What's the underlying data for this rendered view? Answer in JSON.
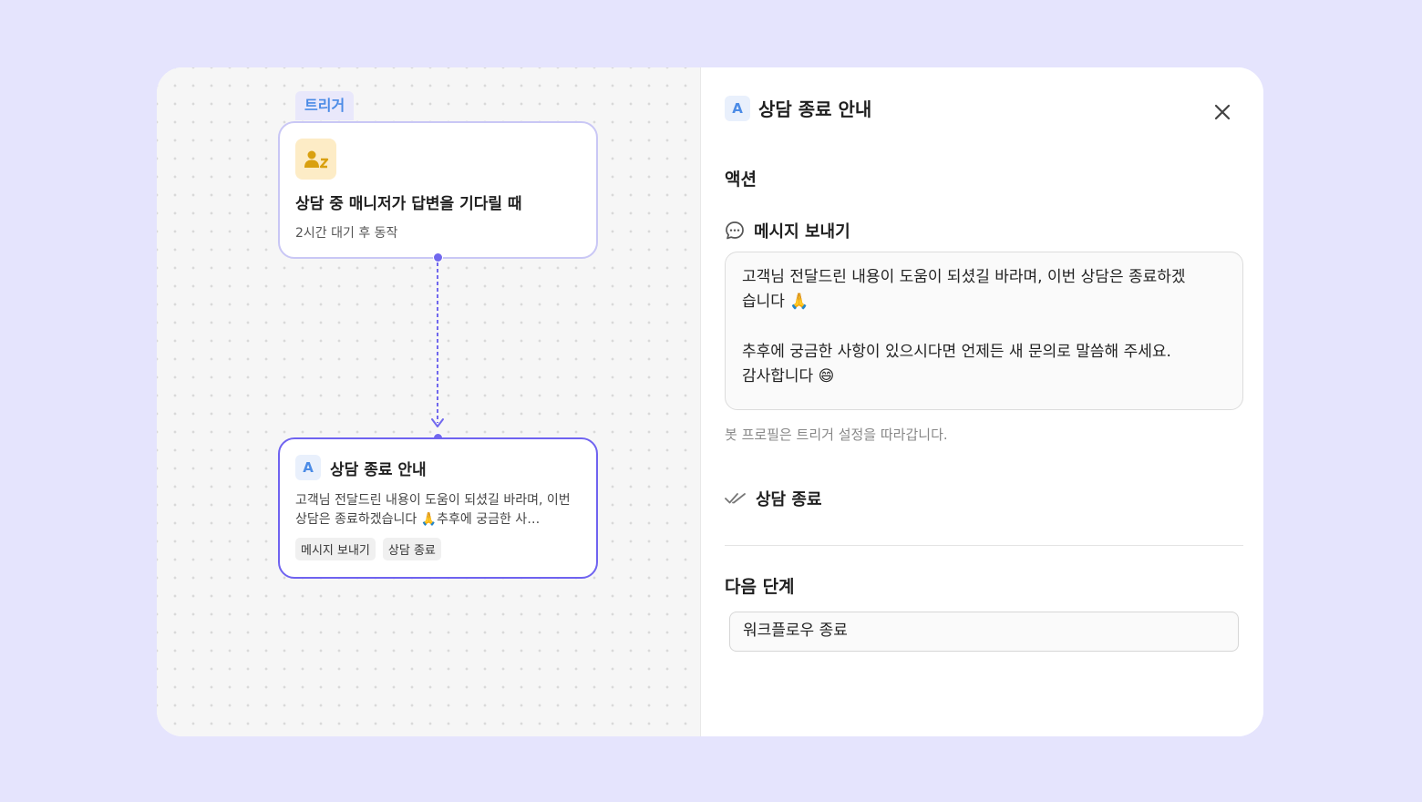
{
  "canvas": {
    "trigger_tag": "트리거",
    "trigger_node": {
      "title": "상담 중 매니저가 답변을 기다릴 때",
      "subtitle": "2시간 대기 후 동작",
      "icon": "person-sleep-icon"
    },
    "action_node": {
      "badge": "A",
      "title": "상담 종료 안내",
      "description": "고객님 전달드린 내용이 도움이 되셨길 바라며, 이번 상담은 종료하겠습니다 🙏추후에 궁금한 사…",
      "chips": [
        "메시지 보내기",
        "상담 종료"
      ]
    }
  },
  "panel": {
    "badge": "A",
    "title": "상담 종료 안내",
    "close_icon": "close-icon",
    "actions_heading": "액션",
    "send_message": {
      "label": "메시지 보내기",
      "icon": "chat-bubble-icon",
      "message_lines": [
        "고객님 전달드린 내용이 도움이 되셨길 바라며, 이번 상담은 종료하겠",
        "습니다 🙏",
        "추후에 궁금한 사항이 있으시다면 언제든 새 문의로 말씀해 주세요.",
        "감사합니다 😄"
      ],
      "hint": "봇 프로필은 트리거 설정을 따라갑니다."
    },
    "close_chat": {
      "label": "상담 종료",
      "icon": "double-check-icon"
    },
    "next_step": {
      "heading": "다음 단계",
      "value": "워크플로우 종료"
    }
  },
  "colors": {
    "background": "#e5e4fd",
    "accent": "#6f63f0",
    "badge_blue": "#4b8be6",
    "trigger_icon_bg": "#fdecc6"
  }
}
